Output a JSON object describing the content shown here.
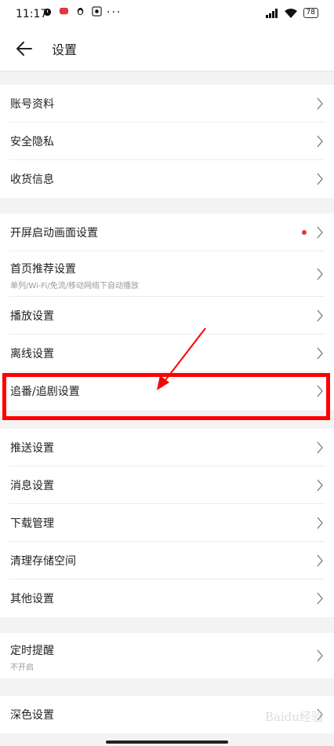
{
  "status": {
    "time": "11:17",
    "battery": "78",
    "icons": [
      "alarm-icon",
      "notification-icon",
      "qq-icon",
      "app-icon",
      "more-dots"
    ]
  },
  "appbar": {
    "title": "设置",
    "back_icon": "arrow-left-icon"
  },
  "groups": [
    {
      "items": [
        {
          "label": "账号资料"
        },
        {
          "label": "安全隐私"
        },
        {
          "label": "收货信息"
        }
      ]
    },
    {
      "items": [
        {
          "label": "开屏启动画面设置",
          "dot": true
        },
        {
          "label": "首页推荐设置",
          "sub": "单列/Wi-Fi/免流/移动网络下自动播放"
        },
        {
          "label": "播放设置"
        },
        {
          "label": "离线设置"
        },
        {
          "label": "追番/追剧设置"
        }
      ]
    },
    {
      "items": [
        {
          "label": "推送设置"
        },
        {
          "label": "消息设置"
        },
        {
          "label": "下载管理"
        },
        {
          "label": "清理存储空间"
        },
        {
          "label": "其他设置"
        }
      ]
    },
    {
      "items": [
        {
          "label": "定时提醒",
          "sub": "不开启"
        }
      ]
    },
    {
      "items": [
        {
          "label": "深色设置"
        }
      ]
    }
  ],
  "annotation": {
    "highlight_color": "#ff0000",
    "dot_color": "#e6343b"
  },
  "watermark": "Baidu经验"
}
